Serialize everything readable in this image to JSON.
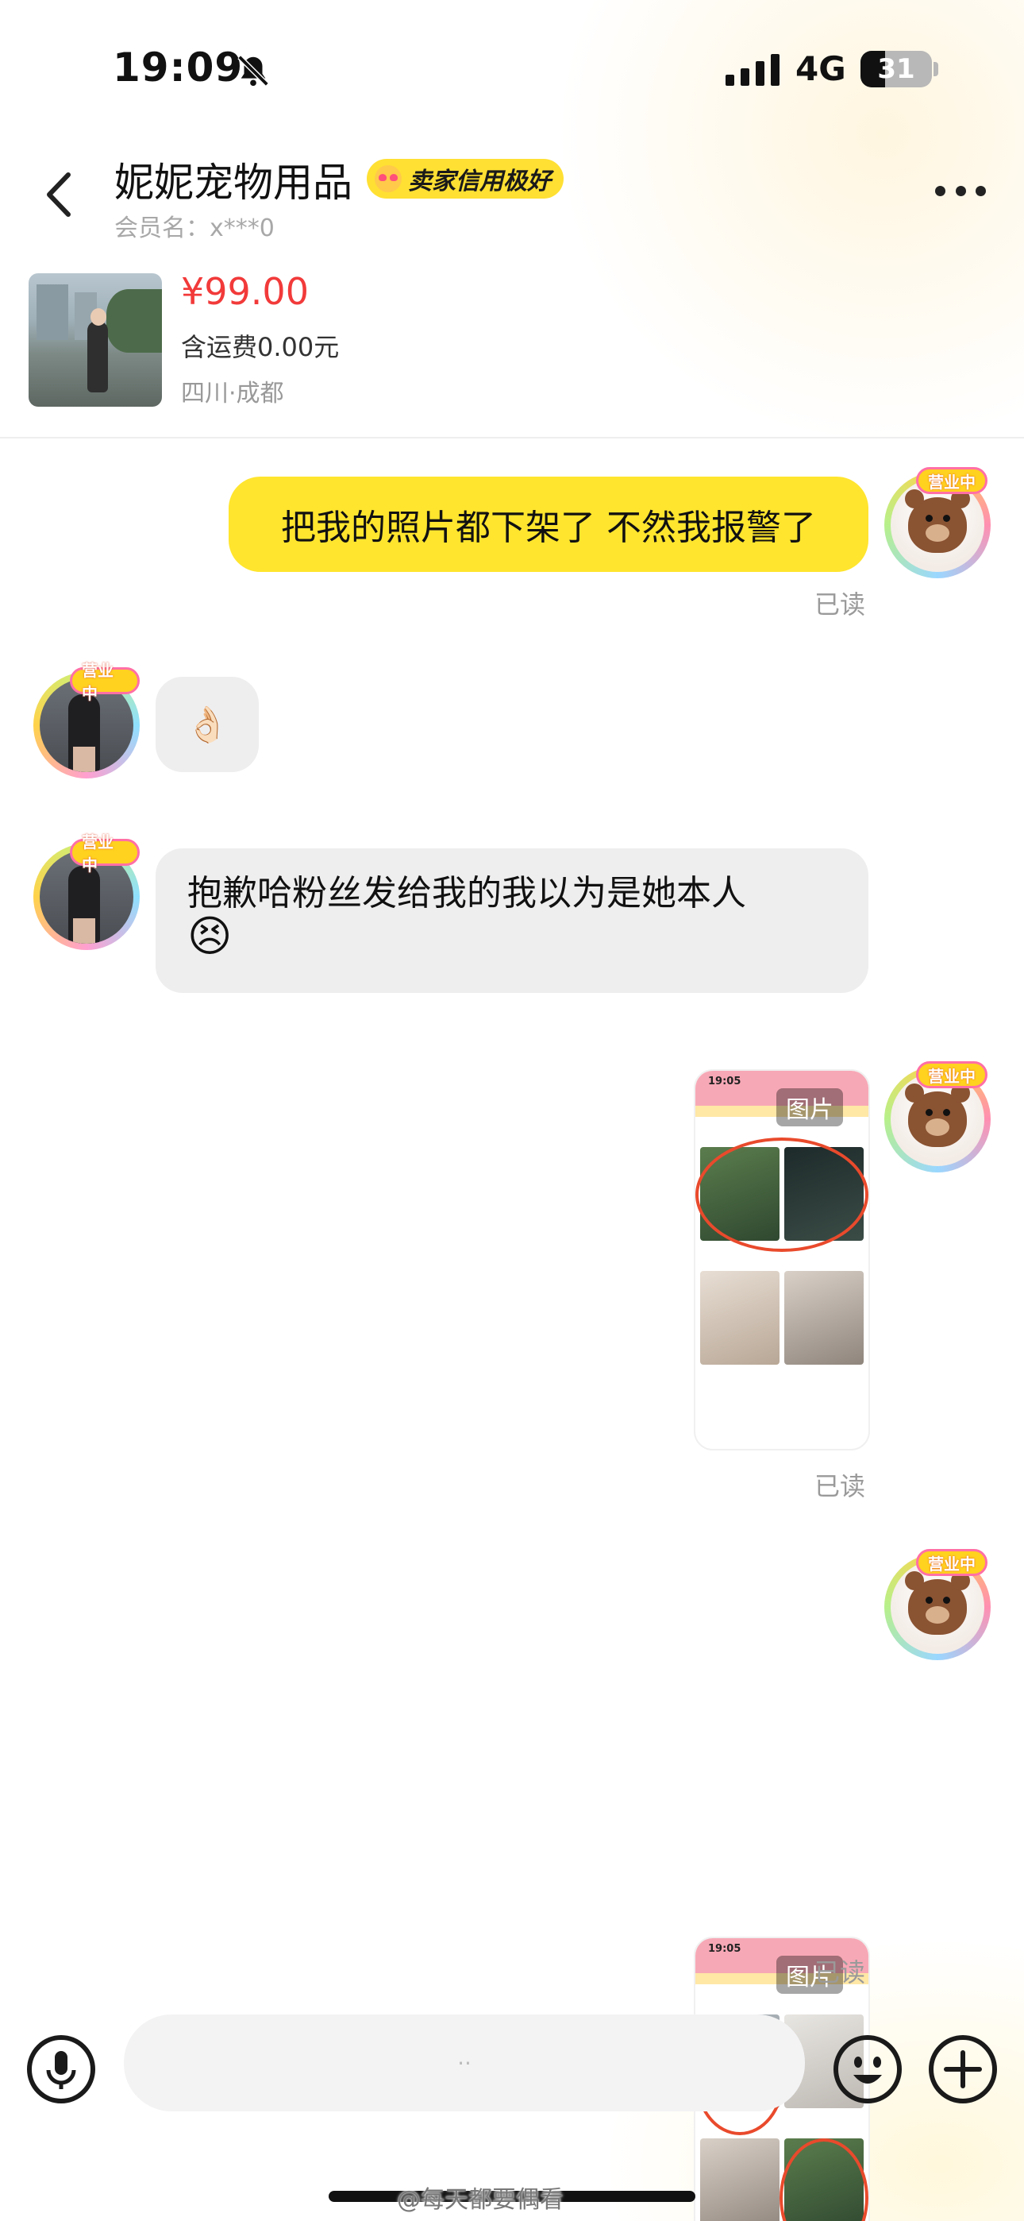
{
  "status_bar": {
    "time": "19:09",
    "network": "4G",
    "battery": "31"
  },
  "header": {
    "shop_name": "妮妮宠物用品",
    "credit_badge": "卖家信用极好",
    "member": "会员名：x***0"
  },
  "product": {
    "price": "¥99.00",
    "shipping": "含运费0.00元",
    "location": "四川·成都"
  },
  "messages": [
    {
      "from": "me",
      "text": "把我的照片都下架了 不然我报警了",
      "status": "已读"
    },
    {
      "from": "seller",
      "text": "👌🏻"
    },
    {
      "from": "seller",
      "text": "抱歉哈粉丝发给我的我以为是她本人",
      "emoji": "😣"
    },
    {
      "from": "me",
      "type": "image",
      "label": "图片",
      "shot_time": "19:05",
      "status": "已读"
    },
    {
      "from": "me",
      "type": "image",
      "label": "图片",
      "shot_time": "19:05",
      "status": "已读"
    }
  ],
  "avatar_tag": "营业中",
  "input": {
    "placeholder": "··"
  },
  "watermark": "@每天都要偶看",
  "colors": {
    "accent_yellow": "#ffe52e",
    "price_red": "#f23a3a",
    "bubble_gray": "#eeeeef",
    "circle_red": "#e94a2c"
  },
  "icons": [
    "bell-slash-icon",
    "signal-icon",
    "battery-icon",
    "back-chevron-icon",
    "more-dots-icon",
    "voice-icon",
    "emoji-icon",
    "plus-icon",
    "bear-avatar-icon"
  ]
}
